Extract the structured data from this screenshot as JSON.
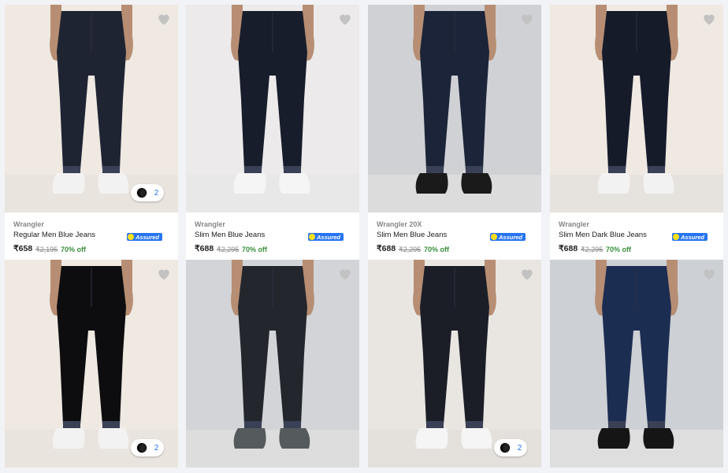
{
  "products": [
    {
      "brand": "Wrangler",
      "title": "Regular Men Blue Jeans",
      "price": "₹658",
      "mrp": "₹2,195",
      "discount": "70% off",
      "assured": "Assured",
      "swatch_count": "2",
      "bg": "#efe9e2",
      "floor": "#e9e4de",
      "jeans": "#1f2433",
      "shoe": "#f2f2f2"
    },
    {
      "brand": "Wrangler",
      "title": "Slim Men Blue Jeans",
      "price": "₹688",
      "mrp": "₹2,295",
      "discount": "70% off",
      "assured": "Assured",
      "bg": "#eceaea",
      "floor": "#e8e8e8",
      "jeans": "#181d2b",
      "shoe": "#f5f5f5"
    },
    {
      "brand": "Wrangler 20X",
      "title": "Slim Men Blue Jeans",
      "price": "₹688",
      "mrp": "₹2,295",
      "discount": "70% off",
      "assured": "Assured",
      "bg": "#cfd1d5",
      "floor": "#dcdcdc",
      "jeans": "#1b2438",
      "shoe": "#1a1a1a"
    },
    {
      "brand": "Wrangler",
      "title": "Slim Men Dark Blue Jeans",
      "price": "₹688",
      "mrp": "₹2,295",
      "discount": "70% off",
      "assured": "Assured",
      "bg": "#efe9e2",
      "floor": "#e6e2dd",
      "jeans": "#161b2a",
      "shoe": "#f2f2f2"
    },
    {
      "bg": "#efe9e2",
      "floor": "#e9e4de",
      "jeans": "#0d0d10",
      "shoe": "#f2f2f2",
      "swatch_count": "2"
    },
    {
      "bg": "#d2d4d7",
      "floor": "#dddddd",
      "jeans": "#23262d",
      "shoe": "#555a5c"
    },
    {
      "bg": "#e9e6e2",
      "floor": "#e4e1dd",
      "jeans": "#1b1e27",
      "shoe": "#f5f5f5",
      "swatch_count": "2"
    },
    {
      "bg": "#cdd0d4",
      "floor": "#dedede",
      "jeans": "#1c2d52",
      "shoe": "#151515"
    }
  ],
  "icons": {
    "wishlist": "heart-icon",
    "assured_badge": "flipkart-assured-icon",
    "color_swatch": "color-swatch-icon"
  }
}
